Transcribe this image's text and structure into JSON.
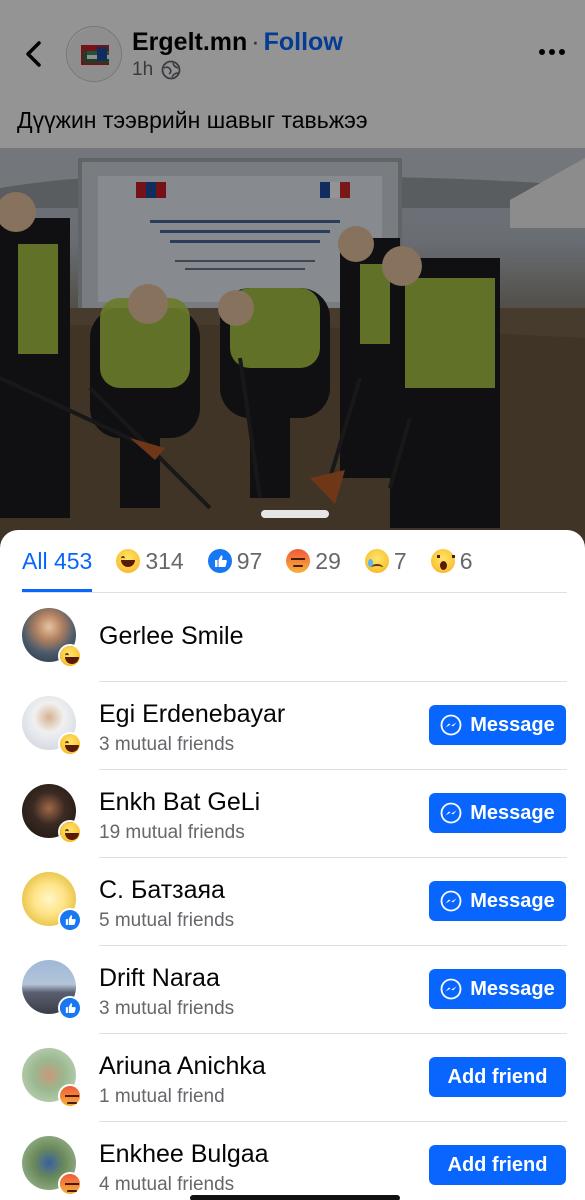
{
  "post": {
    "back_label": "Back",
    "page_name": "Ergelt.mn",
    "separator": "·",
    "follow_label": "Follow",
    "time": "1h",
    "audience_icon": "globe-icon",
    "caption": "Дүүжин тээврийн шавыг тавьжээ",
    "photo_description": "Officials in safety vests shoveling at a groundbreaking ceremony"
  },
  "reactions_sheet": {
    "tabs": [
      {
        "label": "All 453",
        "active": true
      },
      {
        "icon": "haha",
        "count": "314"
      },
      {
        "icon": "like",
        "count": "97"
      },
      {
        "icon": "angry",
        "count": "29"
      },
      {
        "icon": "sad",
        "count": "7"
      },
      {
        "icon": "wow",
        "count": "6"
      }
    ],
    "people": [
      {
        "name": "Gerlee Smile",
        "mutual": "",
        "reaction": "haha",
        "action": ""
      },
      {
        "name": "Egi Erdenebayar",
        "mutual": "3 mutual friends",
        "reaction": "haha",
        "action": "Message"
      },
      {
        "name": "Enkh Bat GeLi",
        "mutual": "19 mutual friends",
        "reaction": "haha",
        "action": "Message"
      },
      {
        "name": "С. Батзаяа",
        "mutual": "5 mutual friends",
        "reaction": "like",
        "action": "Message"
      },
      {
        "name": "Drift Naraa",
        "mutual": "3 mutual friends",
        "reaction": "like",
        "action": "Message"
      },
      {
        "name": "Ariuna Anichka",
        "mutual": "1 mutual friend",
        "reaction": "angry",
        "action": "Add friend"
      },
      {
        "name": "Enkhee Bulgaa",
        "mutual": "4 mutual friends",
        "reaction": "angry",
        "action": "Add friend"
      }
    ]
  },
  "colors": {
    "accent": "#0866ff",
    "text": "#050505",
    "secondary": "#65676b"
  }
}
